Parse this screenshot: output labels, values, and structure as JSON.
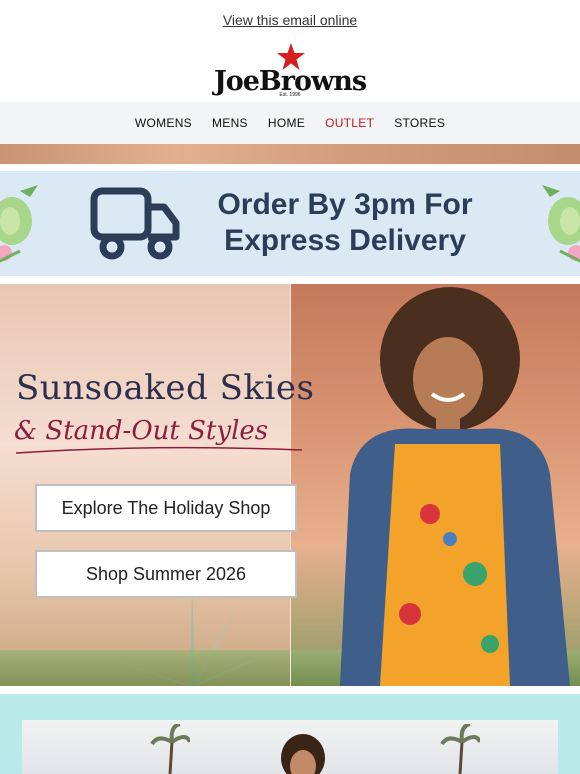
{
  "header": {
    "view_online": "View this email online"
  },
  "logo": {
    "brand": "JoeBrowns",
    "est": "Est. 1996"
  },
  "nav": {
    "items": [
      "WOMENS",
      "MENS",
      "HOME",
      "OUTLET",
      "STORES"
    ],
    "highlight_color": "#c0181e"
  },
  "delivery_banner": {
    "line1": "Order By 3pm For",
    "line2": "Express Delivery",
    "text_color": "#2c3e57",
    "bg_color": "#dbe9f5"
  },
  "hero": {
    "title": "Sunsoaked Skies",
    "subtitle": "& Stand-Out Styles",
    "buttons": [
      "Explore The Holiday Shop",
      "Shop Summer 2026"
    ],
    "title_color": "#2e2f4f",
    "subtitle_color": "#8b1e3f"
  },
  "colors": {
    "nav_bg": "#f3f4f6",
    "promo_bg": "#b9eaea"
  }
}
